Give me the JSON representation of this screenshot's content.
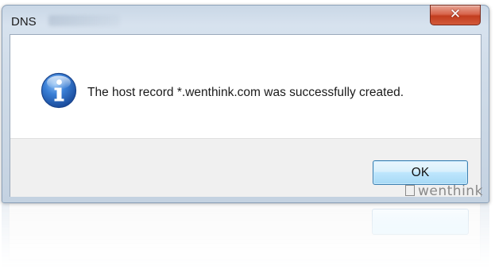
{
  "dialog": {
    "title": "DNS",
    "close_glyph": "✕",
    "message": "The host record *.wenthink.com was successfully created.",
    "icon": "information-icon",
    "ok_label": "OK"
  },
  "watermark": {
    "text": "wenthink"
  },
  "colors": {
    "frame": "#c9d7e6",
    "close_button": "#c23d1f",
    "ok_button_border": "#3c7fb1",
    "info_icon": "#1f5fb4"
  }
}
